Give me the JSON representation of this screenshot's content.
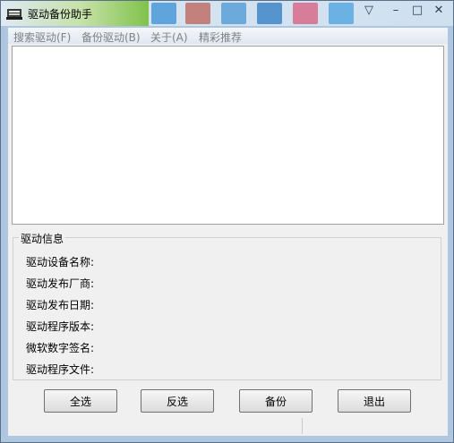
{
  "window": {
    "title": "驱动备份助手"
  },
  "controls": {
    "dropdown": "▽",
    "minimize": "–",
    "maximize": "□",
    "close": "✕"
  },
  "menu": [
    "搜索驱动(F)",
    "备份驱动(B)",
    "关于(A)",
    "精彩推荐"
  ],
  "group": {
    "title": "驱动信息",
    "labels": [
      "驱动设备名称:",
      "驱动发布厂商:",
      "驱动发布日期:",
      "驱动程序版本:",
      "微软数字签名:",
      "驱动程序文件:"
    ]
  },
  "buttons": {
    "select_all": "全选",
    "invert": "反选",
    "backup": "备份",
    "exit": "退出"
  },
  "colors": {
    "titlebar_green": "#7fc24a",
    "disabled_menu": "#808080"
  }
}
